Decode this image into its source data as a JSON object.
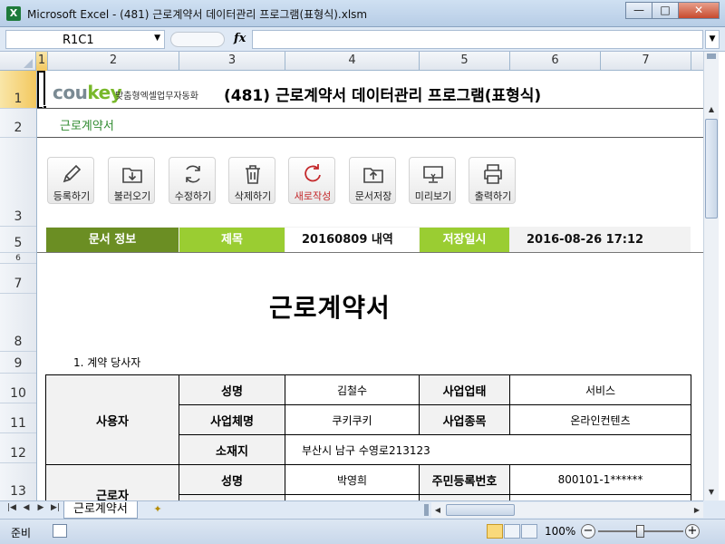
{
  "window": {
    "title": "Microsoft Excel - (481) 근로계약서 데이터관리 프로그램(표형식).xlsm",
    "app_icon": "X",
    "minimize": "—",
    "maximize": "□",
    "close": "✕"
  },
  "formula_bar": {
    "name_box": "R1C1",
    "fx": "fx",
    "formula": ""
  },
  "columns": [
    "1",
    "2",
    "3",
    "4",
    "5",
    "6",
    "7"
  ],
  "rows": [
    "1",
    "2",
    "3",
    "5",
    "6",
    "7",
    "8",
    "9",
    "10",
    "11",
    "12",
    "13"
  ],
  "header": {
    "logo_main": "cou",
    "logo_key": "key",
    "logo_sub": "맞춤형엑셀업무자동화",
    "heading": "(481) 근로계약서 데이터관리 프로그램(표형식)",
    "subtitle": "근로계약서"
  },
  "toolbar": [
    {
      "label": "등록하기",
      "icon": "pencil-icon"
    },
    {
      "label": "불러오기",
      "icon": "folder-download-icon"
    },
    {
      "label": "수정하기",
      "icon": "refresh-icon"
    },
    {
      "label": "삭제하기",
      "icon": "trash-icon"
    },
    {
      "label": "새로작성",
      "icon": "new-icon"
    },
    {
      "label": "문서저장",
      "icon": "folder-upload-icon"
    },
    {
      "label": "미리보기",
      "icon": "monitor-icon"
    },
    {
      "label": "출력하기",
      "icon": "printer-icon"
    }
  ],
  "info": {
    "doc_info_label": "문서 정보",
    "title_label": "제목",
    "title_value": "20160809 내역",
    "saved_label": "저장일시",
    "saved_value": "2016-08-26 17:12"
  },
  "contract": {
    "title": "근로계약서",
    "section1": "1. 계약 당사자",
    "employer_label": "사용자",
    "employee_label": "근로자",
    "rows": {
      "name_label": "성명",
      "name_value": "김철수",
      "biz_type_label": "사업업태",
      "biz_type_value": "서비스",
      "biz_name_label": "사업체명",
      "biz_name_value": "쿠키쿠키",
      "biz_item_label": "사업종목",
      "biz_item_value": "온라인컨텐츠",
      "address_label": "소재지",
      "address_value": "부산시 남구 수영로213123",
      "emp_name_label": "성명",
      "emp_name_value": "박영희",
      "rrn_label": "주민등록번호",
      "rrn_value": "800101-1******"
    }
  },
  "sheet_tabs": {
    "active": "근로계약서"
  },
  "status": {
    "ready": "준비",
    "zoom": "100%"
  },
  "colors": {
    "accent_dark": "#6b8e23",
    "accent_light": "#9acd32",
    "red_label": "#c4282b",
    "subtitle_green": "#2f8a2f"
  }
}
